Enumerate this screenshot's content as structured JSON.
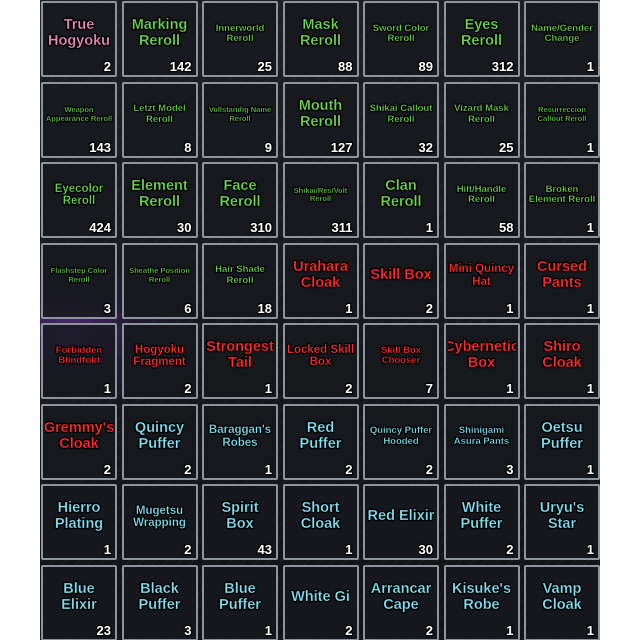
{
  "inventory": {
    "colors": {
      "pink": "#e88bb6",
      "green": "#6bd64e",
      "red": "#ff2a2a",
      "cyan": "#7fe0f2",
      "slot_border": "#8e949c",
      "count": "#ffffff"
    },
    "items": [
      {
        "name": "True Hogyoku",
        "count": "2",
        "color": "pink"
      },
      {
        "name": "Marking Reroll",
        "count": "142",
        "color": "green"
      },
      {
        "name": "Innerworld Reroll",
        "count": "25",
        "color": "green"
      },
      {
        "name": "Mask Reroll",
        "count": "88",
        "color": "green"
      },
      {
        "name": "Sword Color Reroll",
        "count": "89",
        "color": "green"
      },
      {
        "name": "Eyes Reroll",
        "count": "312",
        "color": "green"
      },
      {
        "name": "Name/Gender Change",
        "count": "1",
        "color": "green"
      },
      {
        "name": "Weapon Appearance Reroll",
        "count": "143",
        "color": "green"
      },
      {
        "name": "Letzt Model Reroll",
        "count": "8",
        "color": "green"
      },
      {
        "name": "Vollstandig Name Reroll",
        "count": "9",
        "color": "green"
      },
      {
        "name": "Mouth Reroll",
        "count": "127",
        "color": "green"
      },
      {
        "name": "Shikai Callout Reroll",
        "count": "32",
        "color": "green"
      },
      {
        "name": "Vizard Mask Reroll",
        "count": "25",
        "color": "green"
      },
      {
        "name": "Resurreccion Callout Reroll",
        "count": "1",
        "color": "green"
      },
      {
        "name": "Eyecolor Reroll",
        "count": "424",
        "color": "green"
      },
      {
        "name": "Element Reroll",
        "count": "30",
        "color": "green"
      },
      {
        "name": "Face Reroll",
        "count": "310",
        "color": "green"
      },
      {
        "name": "Shikai/Res/Volt Reroll",
        "count": "311",
        "color": "green"
      },
      {
        "name": "Clan Reroll",
        "count": "1",
        "color": "green"
      },
      {
        "name": "Hilt/Handle Reroll",
        "count": "58",
        "color": "green"
      },
      {
        "name": "Broken Element Reroll",
        "count": "1",
        "color": "green"
      },
      {
        "name": "Flashstep Color Reroll",
        "count": "3",
        "color": "green"
      },
      {
        "name": "Sheathe Position Reroll",
        "count": "6",
        "color": "green"
      },
      {
        "name": "Hair Shade Reroll",
        "count": "18",
        "color": "green"
      },
      {
        "name": "Urahara Cloak",
        "count": "1",
        "color": "red"
      },
      {
        "name": "Skill Box",
        "count": "2",
        "color": "red"
      },
      {
        "name": "Mini Quincy Hat",
        "count": "1",
        "color": "red"
      },
      {
        "name": "Cursed Pants",
        "count": "1",
        "color": "red"
      },
      {
        "name": "Forbidden Blindfold",
        "count": "1",
        "color": "red"
      },
      {
        "name": "Hogyoku Fragment",
        "count": "2",
        "color": "red"
      },
      {
        "name": "Strongest Tail",
        "count": "1",
        "color": "red"
      },
      {
        "name": "Locked Skill Box",
        "count": "2",
        "color": "red"
      },
      {
        "name": "Skill Box Chooser",
        "count": "7",
        "color": "red"
      },
      {
        "name": "Cybernetic Box",
        "count": "1",
        "color": "red"
      },
      {
        "name": "Shiro Cloak",
        "count": "1",
        "color": "red"
      },
      {
        "name": "Gremmy's Cloak",
        "count": "2",
        "color": "red"
      },
      {
        "name": "Quincy Puffer",
        "count": "2",
        "color": "cyan"
      },
      {
        "name": "Baraggan's Robes",
        "count": "1",
        "color": "cyan"
      },
      {
        "name": "Red Puffer",
        "count": "2",
        "color": "cyan"
      },
      {
        "name": "Quincy Puffer Hooded",
        "count": "2",
        "color": "cyan"
      },
      {
        "name": "Shinigami Asura Pants",
        "count": "3",
        "color": "cyan"
      },
      {
        "name": "Oetsu Puffer",
        "count": "1",
        "color": "cyan"
      },
      {
        "name": "Hierro Plating",
        "count": "1",
        "color": "cyan"
      },
      {
        "name": "Mugetsu Wrapping",
        "count": "2",
        "color": "cyan"
      },
      {
        "name": "Spirit Box",
        "count": "43",
        "color": "cyan"
      },
      {
        "name": "Short Cloak",
        "count": "1",
        "color": "cyan"
      },
      {
        "name": "Red Elixir",
        "count": "30",
        "color": "cyan"
      },
      {
        "name": "White Puffer",
        "count": "2",
        "color": "cyan"
      },
      {
        "name": "Uryu's Star",
        "count": "1",
        "color": "cyan"
      },
      {
        "name": "Blue Elixir",
        "count": "23",
        "color": "cyan"
      },
      {
        "name": "Black Puffer",
        "count": "3",
        "color": "cyan"
      },
      {
        "name": "Blue Puffer",
        "count": "1",
        "color": "cyan"
      },
      {
        "name": "White Gi",
        "count": "2",
        "color": "cyan"
      },
      {
        "name": "Arrancar Cape",
        "count": "2",
        "color": "cyan"
      },
      {
        "name": "Kisuke's Robe",
        "count": "1",
        "color": "cyan"
      },
      {
        "name": "Vamp Cloak",
        "count": "1",
        "color": "cyan"
      }
    ]
  }
}
